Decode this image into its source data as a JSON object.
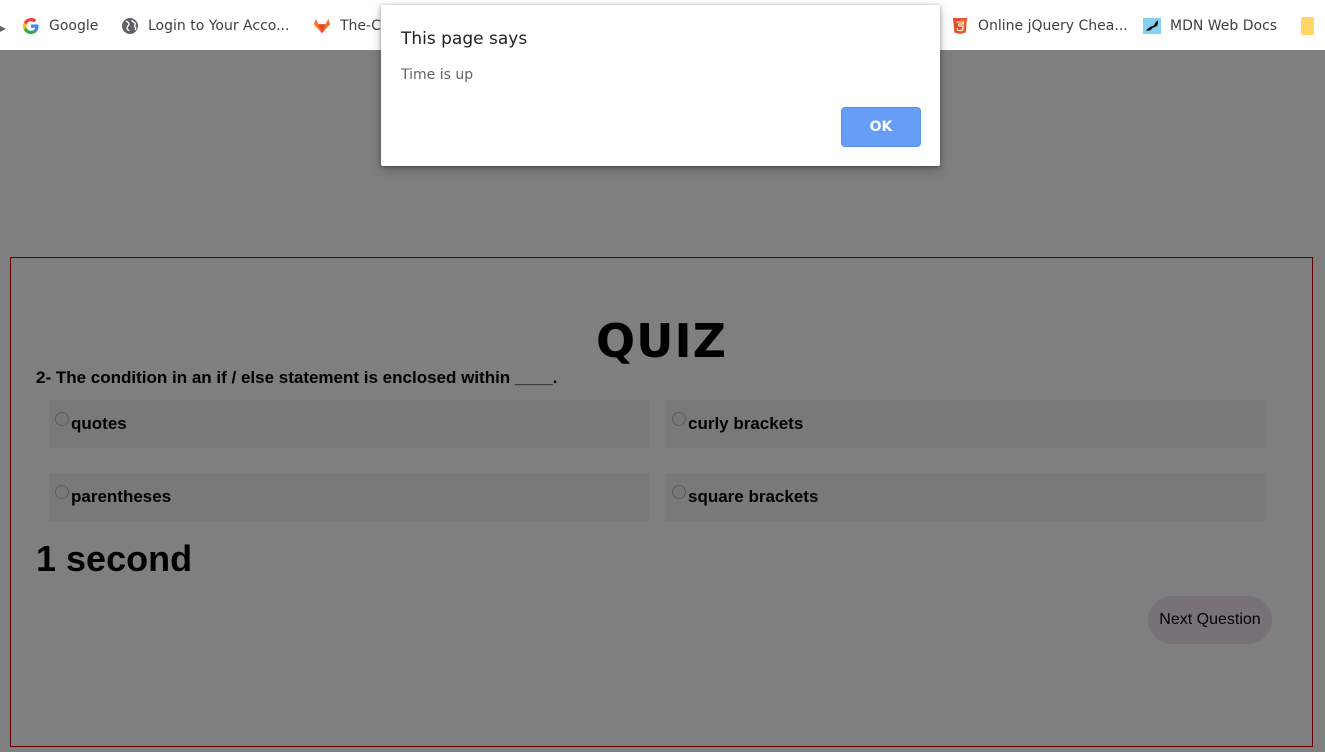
{
  "bookmarks_bar": {
    "items": [
      {
        "label": "Google",
        "icon": "google-icon"
      },
      {
        "label": "Login to Your Acco...",
        "icon": "globe-icon"
      },
      {
        "label": "The-C",
        "icon": "gitlab-icon"
      },
      {
        "label": "Online jQuery Chea...",
        "icon": "html5-icon"
      },
      {
        "label": "MDN Web Docs",
        "icon": "mdn-icon"
      }
    ]
  },
  "quiz": {
    "title": "QUIZ",
    "question": "2- The condition in an if / else statement is enclosed within ____.",
    "options": [
      {
        "label": "quotes",
        "selected": false
      },
      {
        "label": "curly brackets",
        "selected": false
      },
      {
        "label": "parentheses",
        "selected": false
      },
      {
        "label": "square brackets",
        "selected": false
      }
    ],
    "timer": "1 second",
    "next_label": "Next Question"
  },
  "dialog": {
    "title": "This page says",
    "message": "Time is up",
    "ok_label": "OK"
  },
  "colors": {
    "card_border": "#c00000",
    "option_bg": "#f3f3f3",
    "next_button_bg": "#f0e2ef",
    "ok_button_bg": "#669df6",
    "overlay": "rgba(0,0,0,0.5)"
  }
}
